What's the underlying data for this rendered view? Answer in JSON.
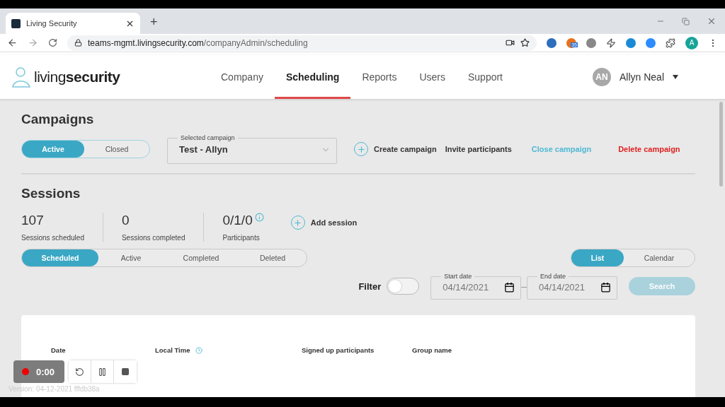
{
  "browser": {
    "tab_title": "Living Security",
    "new_tab": "+",
    "url_host": "teams-mgmt.livingsecurity.com",
    "url_path": "/companyAdmin/scheduling",
    "profile": "A",
    "ext_badge": "35"
  },
  "header": {
    "logo_light": "living",
    "logo_bold": "security",
    "nav": [
      {
        "label": "Company",
        "selected": false
      },
      {
        "label": "Scheduling",
        "selected": true
      },
      {
        "label": "Reports",
        "selected": false
      },
      {
        "label": "Users",
        "selected": false
      },
      {
        "label": "Support",
        "selected": false
      }
    ],
    "user": {
      "initials": "AN",
      "name": "Allyn Neal"
    }
  },
  "campaigns": {
    "title": "Campaigns",
    "toggle": [
      {
        "label": "Active",
        "selected": true
      },
      {
        "label": "Closed",
        "selected": false
      }
    ],
    "select": {
      "label": "Selected campaign",
      "value": "Test - Allyn"
    },
    "create": "Create campaign",
    "invite": "Invite participants",
    "close": "Close campaign",
    "delete": "Delete campaign"
  },
  "sessions": {
    "title": "Sessions",
    "stats": [
      {
        "value": "107",
        "label": "Sessions scheduled",
        "info": false
      },
      {
        "value": "0",
        "label": "Sessions completed",
        "info": false
      },
      {
        "value": "0/1/0",
        "label": "Participants",
        "info": true
      }
    ],
    "add": "Add session",
    "status_tabs": [
      {
        "label": "Scheduled",
        "selected": true
      },
      {
        "label": "Active",
        "selected": false
      },
      {
        "label": "Completed",
        "selected": false
      },
      {
        "label": "Deleted",
        "selected": false
      }
    ],
    "view_tabs": [
      {
        "label": "List",
        "selected": true
      },
      {
        "label": "Calendar",
        "selected": false
      }
    ],
    "filter": {
      "label": "Filter",
      "on": false
    },
    "start": {
      "label": "Start date",
      "value": "04/14/2021"
    },
    "dash": "–",
    "end": {
      "label": "End date",
      "value": "04/14/2021"
    },
    "search": {
      "label": "Search",
      "disabled": true
    },
    "columns": [
      "Date",
      "Local Time",
      "Signed up participants",
      "Group name"
    ]
  },
  "version": "Version: 04-12-2021  fffdb38a",
  "recorder": {
    "time": "0:00"
  }
}
